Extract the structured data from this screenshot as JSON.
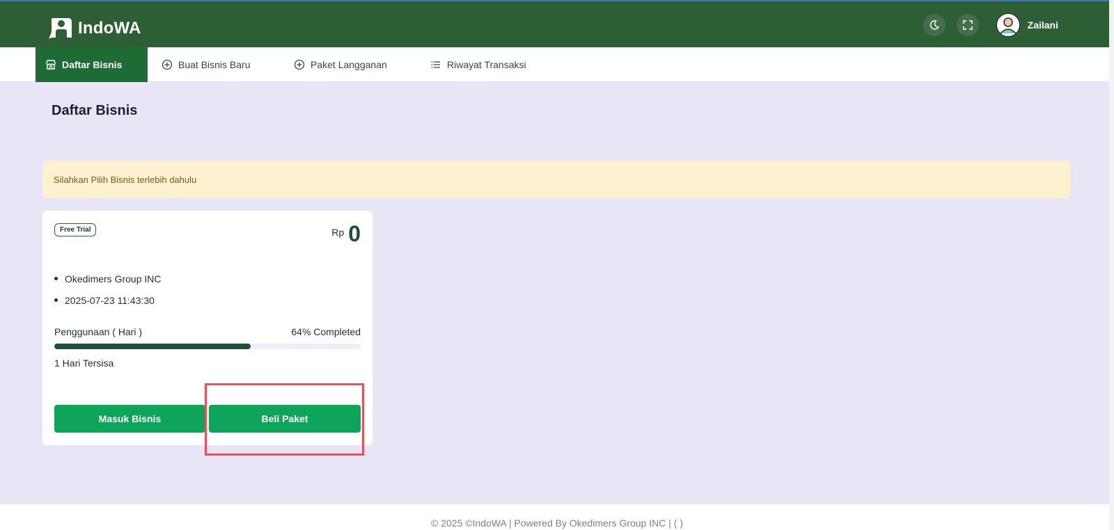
{
  "header": {
    "brand": "IndoWA",
    "user_name": "Zailani",
    "colors": {
      "header_bg": "#2d5f35",
      "accent": "#0ea55a"
    },
    "icons": [
      "moon-icon",
      "fullscreen-icon",
      "user-avatar-icon"
    ]
  },
  "nav": {
    "items": [
      {
        "label": "Daftar Bisnis",
        "icon": "store-icon",
        "active": true
      },
      {
        "label": "Buat Bisnis Baru",
        "icon": "plus-circle-icon",
        "active": false
      },
      {
        "label": "Paket Langganan",
        "icon": "plus-circle-icon",
        "active": false
      },
      {
        "label": "Riwayat Transaksi",
        "icon": "list-icon",
        "active": false
      }
    ]
  },
  "main": {
    "title": "Daftar Bisnis",
    "alert": "Silahkan Pilih Bisnis terlebih dahulu",
    "card": {
      "badge": "Free Trial",
      "currency": "Rp",
      "price": "0",
      "details": [
        "Okedimers Group INC",
        "2025-07-23 11:43:30"
      ],
      "usage_label": "Penggunaan ( Hari )",
      "usage_status": "64% Completed",
      "usage_percent": 64,
      "remaining": "1 Hari Tersisa",
      "buttons": {
        "enter": "Masuk Bisnis",
        "buy": "Beli Paket"
      }
    }
  },
  "footer": {
    "text": "© 2025 ©IndoWA | Powered By Okedimers Group INC | ( )"
  }
}
